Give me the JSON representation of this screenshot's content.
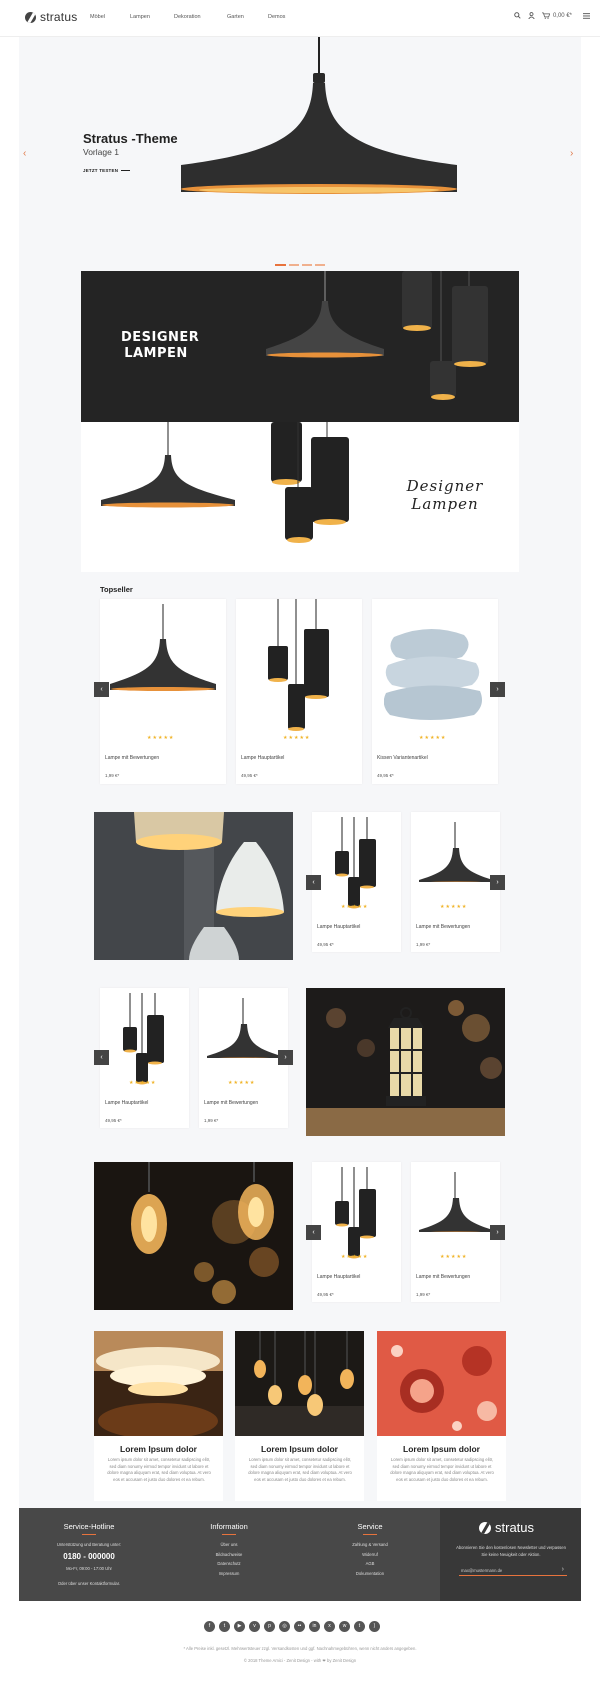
{
  "brand": "stratus",
  "nav": [
    "Möbel",
    "Lampen",
    "Dekoration",
    "Garten",
    "Demos"
  ],
  "header": {
    "cart_total": "0,00 €*"
  },
  "slider": {
    "title": "Stratus -Theme",
    "subtitle": "Vorlage 1",
    "cta": "JETZT TESTEN",
    "dots": 4,
    "active_dot": 0
  },
  "banner": {
    "text_dark": "DESIGNER LAMPEN",
    "text_light": "Designer Lampen"
  },
  "topseller": {
    "title": "Topseller",
    "products": [
      {
        "name": "Lampe mit Bewertungen",
        "price": "1,99 €*",
        "stars": 5,
        "img": "cone-lamp"
      },
      {
        "name": "Lampe Hauptartikel",
        "price": "49,95 €*",
        "stars": 5,
        "img": "pendant-cluster"
      },
      {
        "name": "Kissen Variantenartikel",
        "price": "49,95 €*",
        "stars": 5,
        "img": "pillows"
      }
    ]
  },
  "row_products": [
    {
      "name": "Lampe Hauptartikel",
      "price": "49,95 €*",
      "stars": 5
    },
    {
      "name": "Lampe mit Bewertungen",
      "price": "1,99 €*",
      "stars": 5
    }
  ],
  "blog": [
    {
      "title": "Lorem Ipsum dolor",
      "text": "Lorem ipsum dolor sit amet, consetetur sadipscing elitr, sed diam nonumy eirmod tempor invidunt ut labore et dolore magna aliquyam erat, sed diam voluptua. At vero eos et accusam et justo duo dolores et ea rebum."
    },
    {
      "title": "Lorem Ipsum dolor",
      "text": "Lorem ipsum dolor sit amet, consetetur sadipscing elitr, sed diam nonumy eirmod tempor invidunt ut labore et dolore magna aliquyam erat, sed diam voluptua. At vero eos et accusam et justo duo dolores et ea rebum."
    },
    {
      "title": "Lorem Ipsum dolor",
      "text": "Lorem ipsum dolor sit amet, consetetur sadipscing elitr, sed diam nonumy eirmod tempor invidunt ut labore et dolore magna aliquyam erat, sed diam voluptua. At vero eos et accusam et justo duo dolores et ea rebum."
    }
  ],
  "footer": {
    "hotline": {
      "title": "Service-Hotline",
      "line1": "Unterstützung und Beratung unter:",
      "phone": "0180 - 000000",
      "hours": "Mo-Fr, 09:00 - 17:00 Uhr",
      "line2": "Oder über unser Kontaktformular."
    },
    "information": {
      "title": "Information",
      "links": [
        "Über uns",
        "Bildnachweise",
        "Datenschutz",
        "Impressum"
      ]
    },
    "service": {
      "title": "Service",
      "links": [
        "Zahlung & Versand",
        "Widerruf",
        "AGB",
        "Dokumentation"
      ]
    },
    "newsletter": {
      "brand": "stratus",
      "text": "Abonnieren Sie den kostenlosen Newsletter und verpassen Sie keine Neuigkeit oder Aktion.",
      "placeholder": "max@mustermann.de"
    }
  },
  "bottom": {
    "vat": "* Alle Preise inkl. gesetzl. Mehrwertsteuer zzgl. Versandkosten und ggf. Nachnahmegebühren, wenn nicht anders angegeben.",
    "credit": "© 2018 Theme Amici - Zenit Design - with ❤ by Zenit Design"
  },
  "social_icons": [
    "facebook-icon",
    "twitter-icon",
    "youtube-icon",
    "vimeo-icon",
    "pinterest-icon",
    "instagram-icon",
    "flickr-icon",
    "linkedin-icon",
    "xing-icon",
    "whatsapp-icon",
    "tumblr-icon",
    "rss-icon"
  ],
  "colors": {
    "accent": "#e8733d",
    "stars": "#f0b429",
    "dark": "#242424",
    "footer": "#484848"
  }
}
